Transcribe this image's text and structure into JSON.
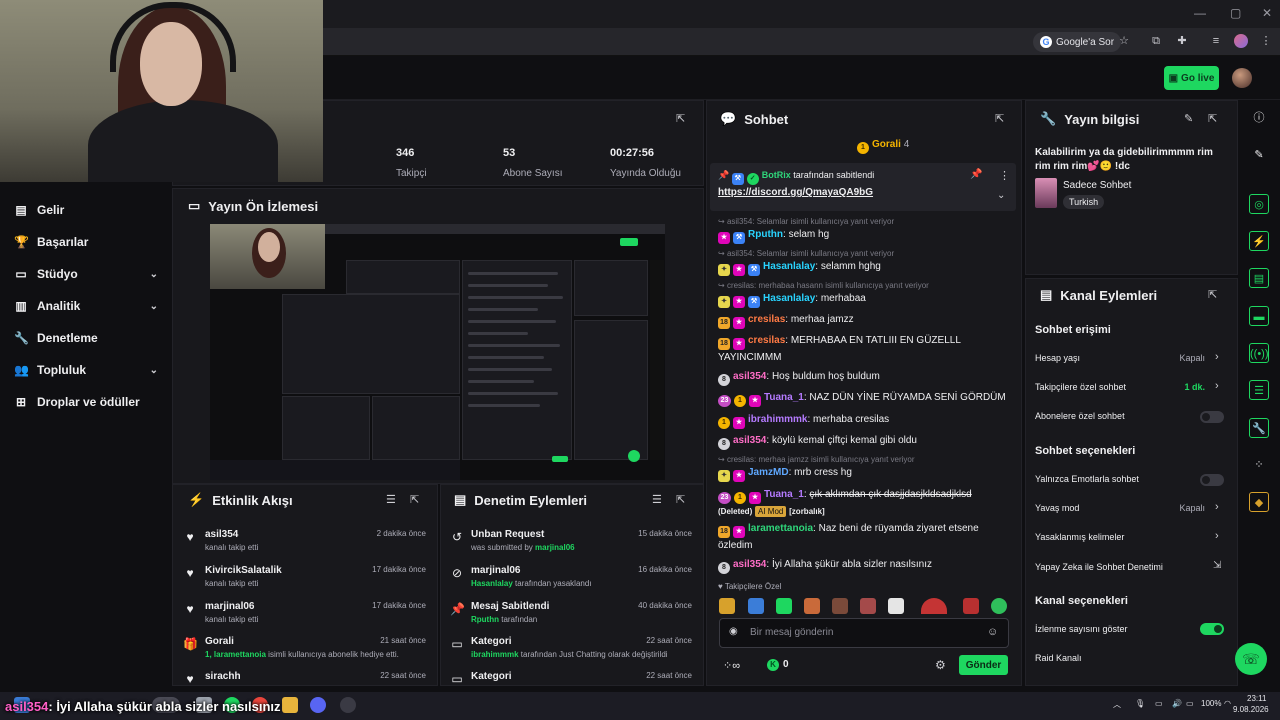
{
  "browser": {
    "google_sor": "Google'a Sor"
  },
  "header": {
    "go_live": "Go live"
  },
  "sidebar": {
    "items": [
      {
        "label": "Gelir",
        "icon": "revenue-icon",
        "has_chevron": false
      },
      {
        "label": "Başarılar",
        "icon": "trophy-icon",
        "has_chevron": false
      },
      {
        "label": "Stüdyo",
        "icon": "studio-icon",
        "has_chevron": true
      },
      {
        "label": "Analitik",
        "icon": "analytics-icon",
        "has_chevron": true
      },
      {
        "label": "Denetleme",
        "icon": "wrench-icon",
        "has_chevron": false
      },
      {
        "label": "Topluluk",
        "icon": "community-icon",
        "has_chevron": true
      },
      {
        "label": "Droplar ve ödüller",
        "icon": "drops-icon",
        "has_chevron": false
      }
    ]
  },
  "stats": [
    {
      "value": "346",
      "label": "Takipçi"
    },
    {
      "value": "53",
      "label": "Abone Sayısı"
    },
    {
      "value": "00:27:56",
      "label": "Yayında Olduğu Süre"
    }
  ],
  "preview": {
    "title": "Yayın Ön İzlemesi"
  },
  "activity": {
    "title": "Etkinlik Akışı",
    "items": [
      {
        "user": "asil354",
        "sub": "kanalı takip etti",
        "time": "2 dakika önce",
        "icon": "heart-icon"
      },
      {
        "user": "KivircikSalatalik",
        "sub": "kanalı takip etti",
        "time": "17 dakika önce",
        "icon": "heart-icon"
      },
      {
        "user": "marjinal06",
        "sub": "kanalı takip etti",
        "time": "17 dakika önce",
        "icon": "heart-icon"
      },
      {
        "user": "Gorali",
        "sub_prefix": "1, ",
        "sub_user": "laramettanoia",
        "sub": " isimli kullanıcıya abonelik hediye etti.",
        "time": "21 saat önce",
        "icon": "gift-icon"
      },
      {
        "user": "sirachh",
        "sub": "",
        "time": "22 saat önce",
        "icon": "heart-icon"
      }
    ]
  },
  "moderation": {
    "title": "Denetim Eylemleri",
    "items": [
      {
        "title": "Unban Request",
        "sub": "was submitted by ",
        "sub_user": "marjinal06",
        "sub_tail": "",
        "time": "15 dakika önce",
        "icon": "unban-icon"
      },
      {
        "title": "marjinal06",
        "sub_user": "Hasanlalay",
        "sub": "",
        "sub_tail": " tarafından yasaklandı",
        "time": "16 dakika önce",
        "icon": "ban-icon"
      },
      {
        "title": "Mesaj Sabitlendi",
        "sub_user": "Rputhn",
        "sub": "",
        "sub_tail": " tarafından",
        "time": "40 dakika önce",
        "icon": "pin-icon"
      },
      {
        "title": "Kategori",
        "sub_user": "ibrahimmmk",
        "sub": "",
        "sub_tail": " tarafından Just Chatting olarak değiştirildi",
        "time": "22 saat önce",
        "icon": "category-icon"
      },
      {
        "title": "Kategori",
        "sub": "",
        "sub_user": "",
        "sub_tail": "",
        "time": "22 saat önce",
        "icon": "category-icon"
      }
    ]
  },
  "chat": {
    "title": "Sohbet",
    "top_gifter": "Gorali",
    "top_gifter_count": "4",
    "pinned_by": "BotRix",
    "pinned_suffix": "tarafından sabitlendi",
    "pinned_link": "https://discord.gg/QmayaQA9bG",
    "messages": [
      {
        "reply": "asil354: Selamlar isimli kullanıcıya yanıt veriyor",
        "user": "Rputhn",
        "user_color": "#29d4ff",
        "text": "selam hg"
      },
      {
        "reply": "asil354: Selamlar isimli kullanıcıya yanıt veriyor",
        "user": "Hasanlalay",
        "user_color": "#29d4ff",
        "text": "selamm hghg"
      },
      {
        "reply": "cresilas: merhabaa hasann isimli kullanıcıya yanıt veriyor",
        "user": "Hasanlalay",
        "user_color": "#29d4ff",
        "text": "merhabaa"
      },
      {
        "reply": "",
        "user": "cresilas",
        "user_color": "#ff7a45",
        "text": "merhaa jamzz"
      },
      {
        "reply": "",
        "user": "cresilas",
        "user_color": "#ff7a45",
        "text": "MERHABAA EN TATLIII EN GÜZELLL YAYINCIMMM"
      },
      {
        "reply": "",
        "user": "asil354",
        "user_color": "#ff6ec7",
        "text": "Hoş buldum hoş buldum"
      },
      {
        "reply": "",
        "user": "Tuana_1",
        "user_color": "#b57bff",
        "text": "NAZ DÜN YİNE RÜYAMDA SENİ GÖRDÜM"
      },
      {
        "reply": "",
        "user": "ibrahimmmk",
        "user_color": "#b57bff",
        "text": "merhaba cresilas"
      },
      {
        "reply": "",
        "user": "asil354",
        "user_color": "#ff6ec7",
        "text": "köylü kemal çiftçi kemal gibi oldu"
      },
      {
        "reply": "cresilas: merhaa jamzz isimli kullanıcıya yanıt veriyor",
        "user": "JamzMD",
        "user_color": "#5fa8ff",
        "text": "mrb cress hg"
      },
      {
        "reply": "",
        "user": "Tuana_1",
        "user_color": "#b57bff",
        "text": "çık aklımdan çık dasjjdasjkldsadjklsd",
        "deleted": "(Deleted)",
        "tag": "AI Mod",
        "tag2": "[zorbalık]"
      },
      {
        "reply": "",
        "user": "laramettanoia",
        "user_color": "#2fd67b",
        "text": "Naz beni de rüyamda ziyaret etsene özledim"
      },
      {
        "reply": "",
        "user": "asil354",
        "user_color": "#ff6ec7",
        "text": "İyi Allaha şükür abla sizler nasılsınız"
      }
    ],
    "followers_only": "Takipçilere Özel",
    "input_placeholder": "Bir mesaj gönderin",
    "points": "0",
    "send": "Gönder"
  },
  "stream_info": {
    "title": "Yayın bilgisi",
    "stream_title": "Kalabilirim ya da gidebilirimmmm rim rim rim rim💕🙂 !dc",
    "category": "Sadece Sohbet",
    "tag": "Turkish"
  },
  "channel_actions": {
    "title": "Kanal Eylemleri",
    "chat_access": "Sohbet erişimi",
    "rows1": [
      {
        "label": "Hesap yaşı",
        "value": "Kapalı",
        "control": "chevron"
      },
      {
        "label": "Takipçilere özel sohbet",
        "value": "1 dk.",
        "control": "chevron",
        "value_green": true
      },
      {
        "label": "Abonelere özel sohbet",
        "value": "",
        "control": "toggle-off"
      }
    ],
    "chat_options": "Sohbet seçenekleri",
    "rows2": [
      {
        "label": "Yalnızca Emotlarla sohbet",
        "value": "",
        "control": "toggle-off"
      },
      {
        "label": "Yavaş mod",
        "value": "Kapalı",
        "control": "chevron"
      },
      {
        "label": "Yasaklanmış kelimeler",
        "value": "",
        "control": "chevron"
      },
      {
        "label": "Yapay Zeka ile Sohbet Denetimi",
        "value": "",
        "control": "external"
      }
    ],
    "channel_options": "Kanal seçenekleri",
    "rows3": [
      {
        "label": "İzlenme sayısını göster",
        "value": "",
        "control": "toggle-on"
      },
      {
        "label": "Raid Kanalı",
        "value": "",
        "control": ""
      }
    ]
  },
  "taskbar": {
    "overlay_user": "asil354",
    "overlay_text": ": İyi Allaha şükür abla sizler nasılsınız",
    "battery": "100%",
    "time": "23:11",
    "date": "9.08.2026"
  },
  "colors": {
    "accent": "#1ed760",
    "panel": "#18181c",
    "background": "#0f0f12"
  }
}
